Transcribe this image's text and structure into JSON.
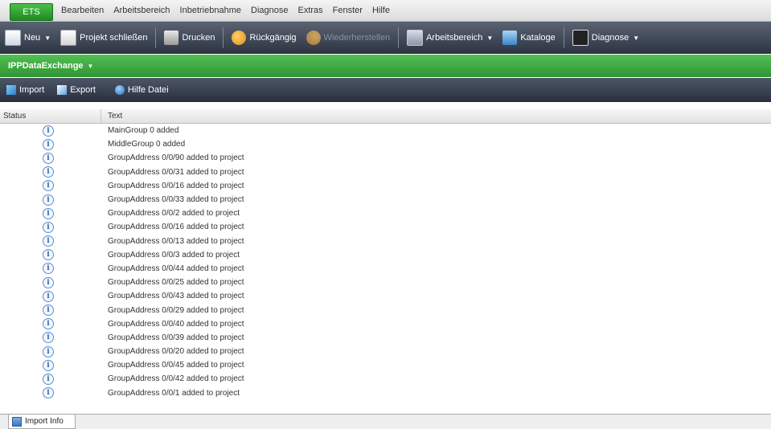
{
  "app": {
    "ets_label": "ETS"
  },
  "menu": [
    "Bearbeiten",
    "Arbeitsbereich",
    "Inbetriebnahme",
    "Diagnose",
    "Extras",
    "Fenster",
    "Hilfe"
  ],
  "toolbar": {
    "new_label": "Neu",
    "close_project_label": "Projekt schließen",
    "print_label": "Drucken",
    "undo_label": "Rückgängig",
    "redo_label": "Wiederherstellen",
    "workspace_label": "Arbeitsbereich",
    "catalogs_label": "Kataloge",
    "diagnose_label": "Diagnose"
  },
  "panel": {
    "title": "IPPDataExchange"
  },
  "subtoolbar": {
    "import_label": "Import",
    "export_label": "Export",
    "help_label": "Hilfe Datei"
  },
  "table": {
    "columns": [
      "Status",
      "Text"
    ],
    "rows": [
      "MainGroup 0 added",
      "MiddleGroup 0 added",
      "GroupAddress 0/0/90 added to project",
      "GroupAddress 0/0/31 added to project",
      "GroupAddress 0/0/16 added to project",
      "GroupAddress 0/0/33 added to project",
      "GroupAddress 0/0/2 added to project",
      "GroupAddress 0/0/16 added to project",
      "GroupAddress 0/0/13 added to project",
      "GroupAddress 0/0/3 added to project",
      "GroupAddress 0/0/44 added to project",
      "GroupAddress 0/0/25 added to project",
      "GroupAddress 0/0/43 added to project",
      "GroupAddress 0/0/29 added to project",
      "GroupAddress 0/0/40 added to project",
      "GroupAddress 0/0/39 added to project",
      "GroupAddress 0/0/20 added to project",
      "GroupAddress 0/0/45 added to project",
      "GroupAddress 0/0/42 added to project",
      "GroupAddress 0/0/1 added to project"
    ]
  },
  "bottom_tab": {
    "label": "Import Info"
  }
}
